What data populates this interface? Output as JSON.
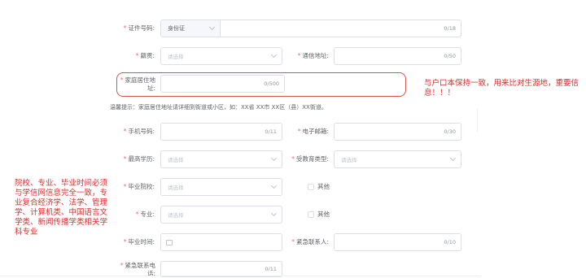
{
  "form": {
    "id_number": {
      "label": "证件号码:",
      "type_value": "身份证",
      "counter": "0/18"
    },
    "native_place": {
      "label": "籍贯:",
      "placeholder": "请选择"
    },
    "mail_address": {
      "label": "通信地址:",
      "counter": "0/50"
    },
    "home_address": {
      "label_line1": "家庭居住地",
      "label_line2": "址:",
      "counter": "0/500"
    },
    "hint": "温馨提示：家庭居住地址请详细到街道或小区，如：XX省 XX市 XX区（县）XX街道。",
    "mobile": {
      "label": "手机号码:",
      "counter": "0/11"
    },
    "email": {
      "label": "电子邮箱:",
      "counter": "0/30"
    },
    "education": {
      "label": "最高学历:",
      "placeholder": "请选择"
    },
    "edu_type": {
      "label": "受教育类型:",
      "placeholder": "请选择"
    },
    "school": {
      "label": "毕业院校:",
      "placeholder": "请选择",
      "other_label": "其他"
    },
    "major": {
      "label": "专业:",
      "placeholder": "请选择",
      "other_label": "其他"
    },
    "grad_time": {
      "label": "毕业时间:"
    },
    "emergency_contact": {
      "label": "紧急联系人:",
      "counter": "0/10"
    },
    "emergency_phone": {
      "label_line1": "紧急联系电",
      "label_line2": "话:",
      "counter": "0/11"
    }
  },
  "annotations": {
    "right_note": "与户口本保持一致，用来比对生源地，重要信息！！！",
    "left_note": "院校、专业、毕业时间必须与学信网信息完全一致，专业复合经济学、法学、管理学、计算机类、中国语言文学类、新闻传播学类相关学科专业"
  },
  "colors": {
    "required": "#f56c6c",
    "annotation": "#e02b2b",
    "border": "#dcdfe6"
  }
}
